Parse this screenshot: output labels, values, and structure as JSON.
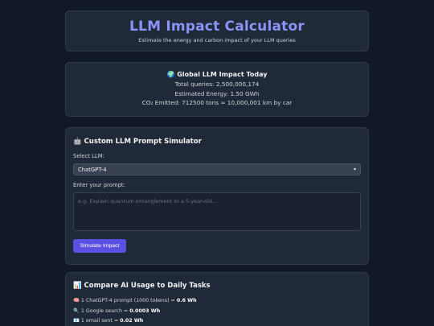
{
  "header": {
    "title": "LLM Impact Calculator",
    "subtitle": "Estimate the energy and carbon impact of your LLM queries"
  },
  "global": {
    "icon": "globe-icon",
    "title": "🌍 Global LLM Impact Today",
    "total_queries": "Total queries: 2,500,000,174",
    "energy": "Estimated Energy: 1.50 GWh",
    "co2": "CO₂ Emitted: 712500 tons ≈ 10,000,001 km by car"
  },
  "simulator": {
    "icon": "robot-icon",
    "title": "🤖 Custom LLM Prompt Simulator",
    "select_label": "Select LLM:",
    "selected_model": "ChatGPT-4",
    "prompt_label": "Enter your prompt:",
    "prompt_placeholder": "e.g. Explain quantum entanglement to a 5-year-old...",
    "prompt_value": "",
    "button_label": "Simulate Impact"
  },
  "compare": {
    "icon": "chart-icon",
    "title": "📊 Compare AI Usage to Daily Tasks",
    "rows": [
      {
        "icon": "brain-icon",
        "prefix": "🧠 1 ChatGPT-4 prompt (1000 tokens) ≈ ",
        "value": "0.6 Wh"
      },
      {
        "icon": "search-icon",
        "prefix": "🔍 1 Google search ≈ ",
        "value": "0.0003 Wh"
      },
      {
        "icon": "email-icon",
        "prefix": "📧 1 email sent ≈ ",
        "value": "0.02 Wh"
      }
    ]
  },
  "colors": {
    "background": "#111827",
    "card": "#1f2937",
    "title_accent": "#8b93f8",
    "button": "#5b50e3"
  }
}
